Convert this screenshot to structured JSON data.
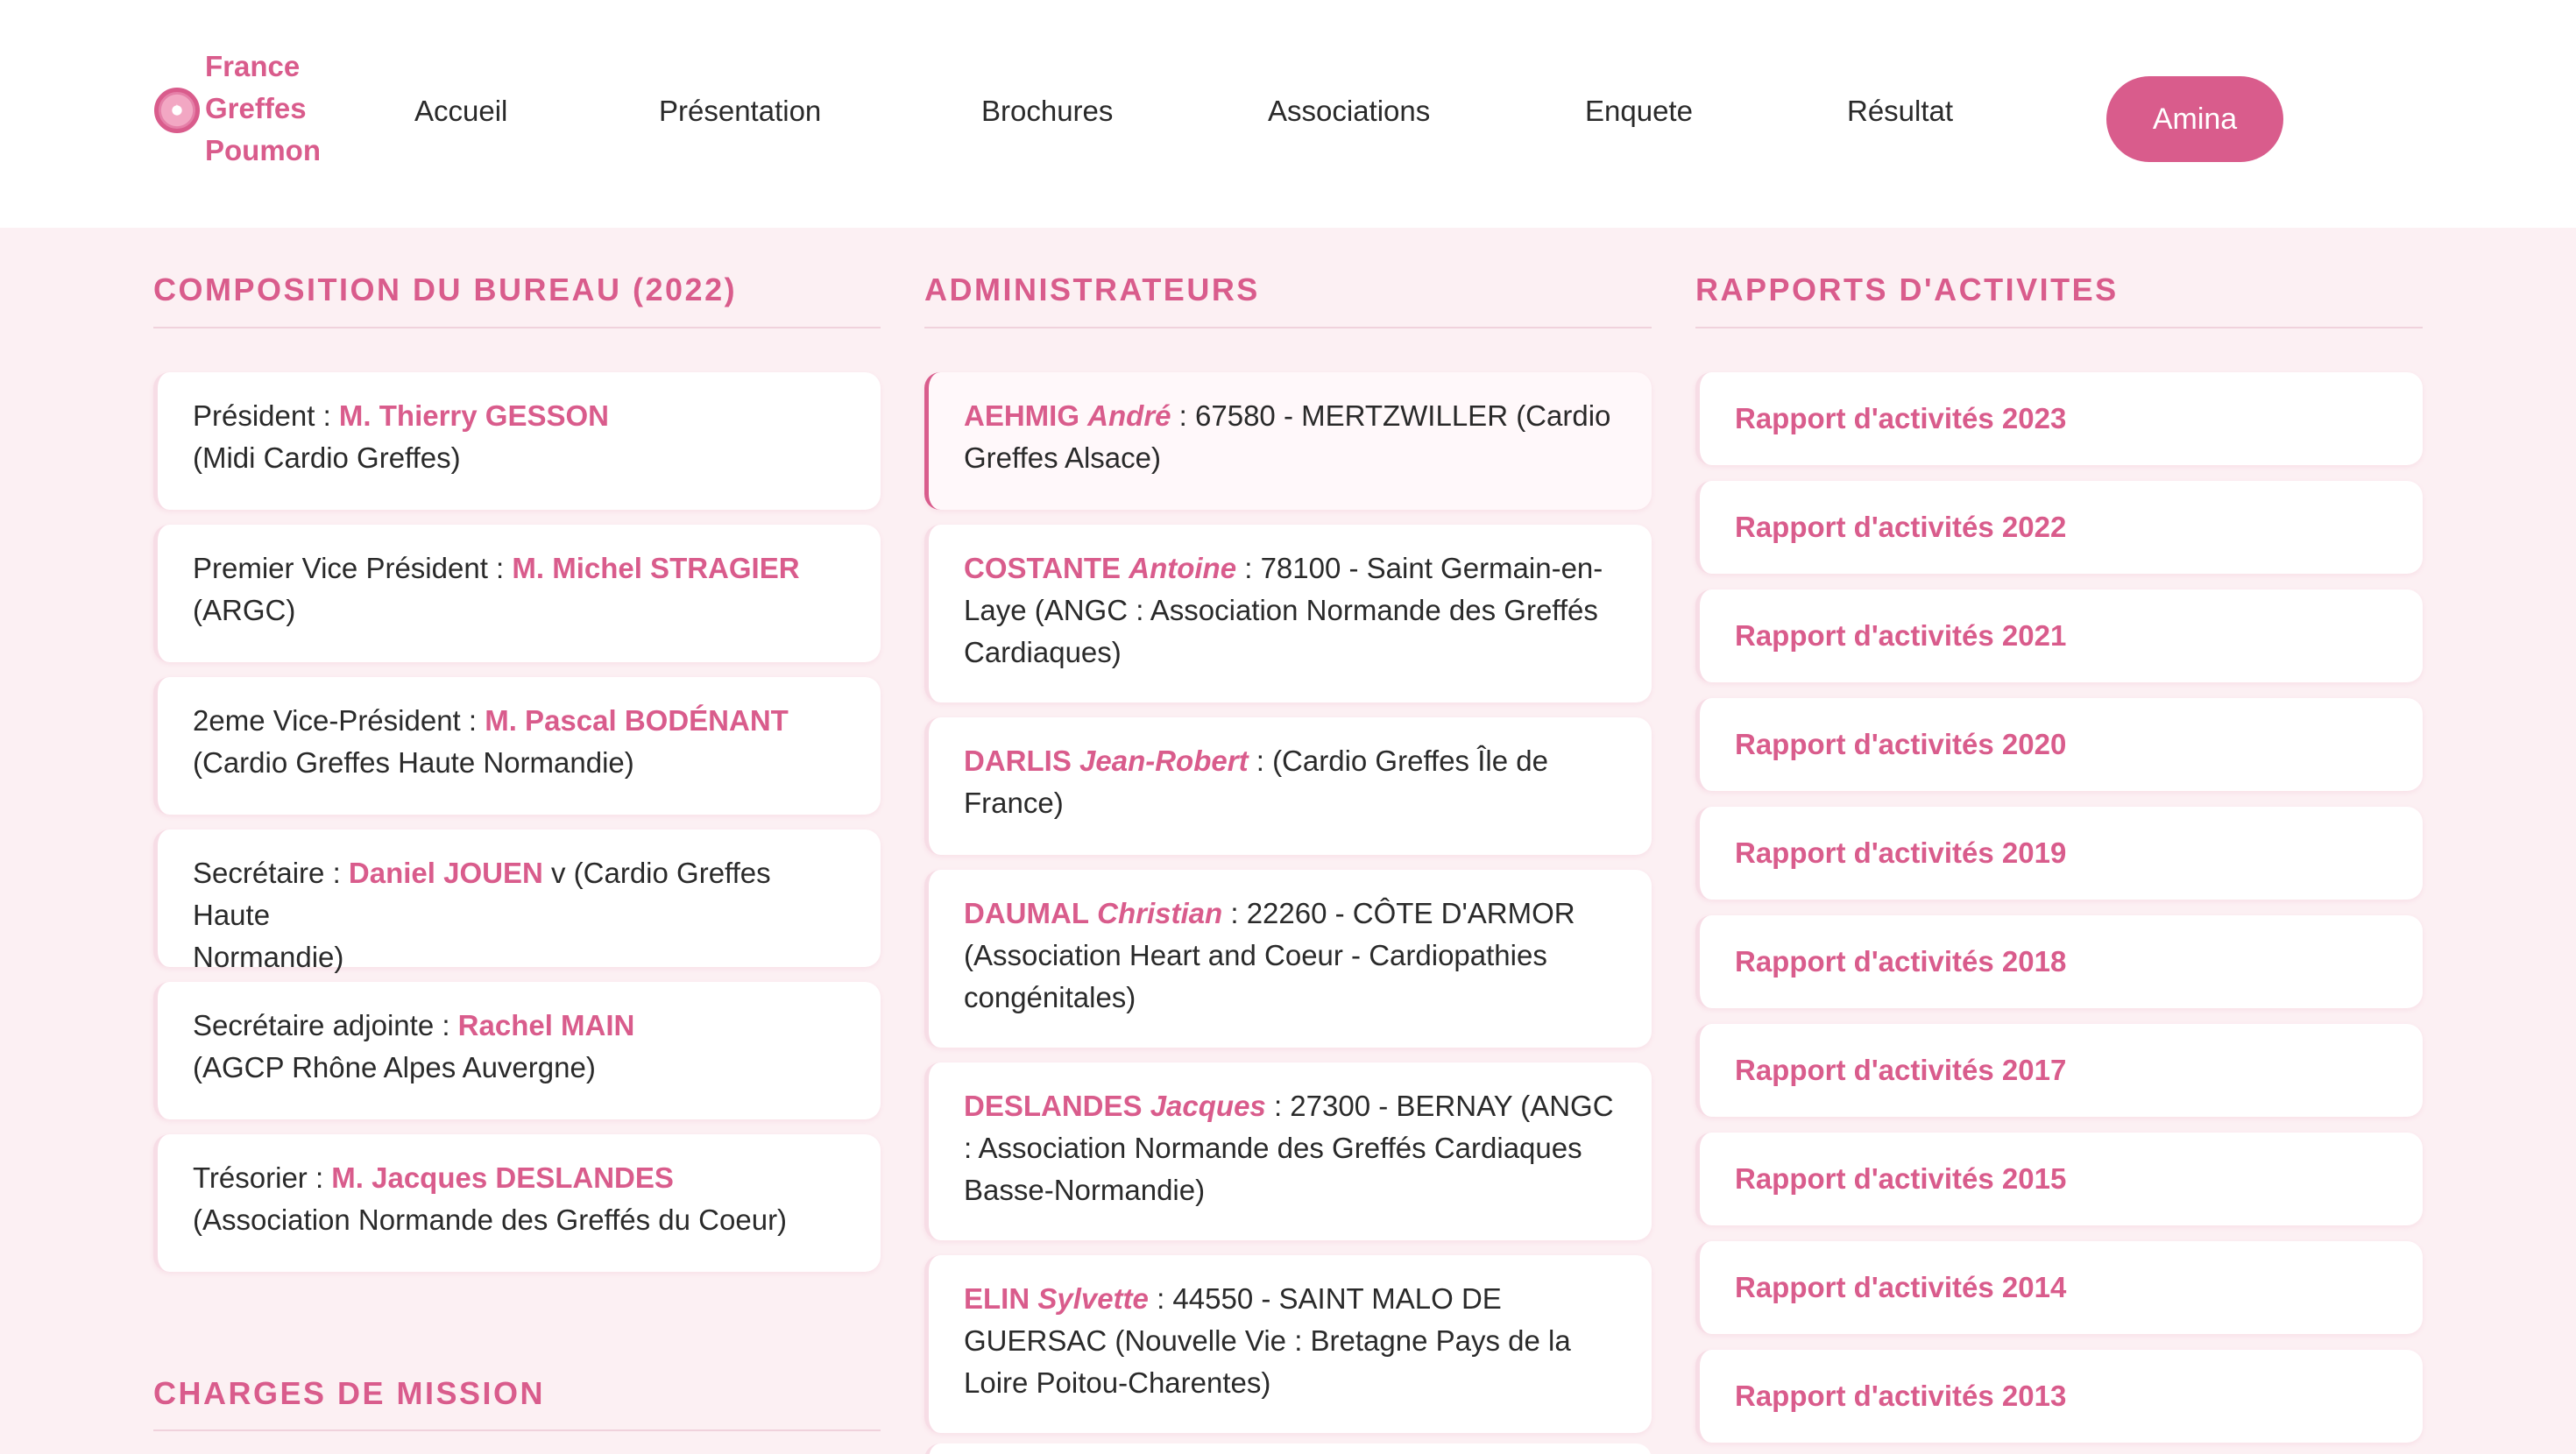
{
  "brand": {
    "line1": "France",
    "line2": "Greffes",
    "line3": "Poumon",
    "accent_color": "#d95c8c"
  },
  "nav": {
    "items": [
      "Accueil",
      "Présentation",
      "Brochures",
      "Associations",
      "Enquete",
      "Résultat"
    ],
    "user_button": "Amina"
  },
  "bureau": {
    "title": "COMPOSITION DU BUREAU (2022)",
    "members": [
      {
        "role": "Président : ",
        "name": "M. Thierry GESSON",
        "after": "",
        "org": "(Midi Cardio Greffes)"
      },
      {
        "role": "Premier Vice Président : ",
        "name": "M. Michel STRAGIER",
        "after": "",
        "org": "(ARGC)"
      },
      {
        "role": "2eme Vice-Président : ",
        "name": "M. Pascal BODÉNANT",
        "after": "",
        "org": "(Cardio Greffes Haute Normandie)"
      },
      {
        "role": "Secrétaire : ",
        "name": "Daniel JOUEN",
        "after": " v (Cardio Greffes Haute",
        "org": "Normandie)"
      },
      {
        "role": "Secrétaire adjointe : ",
        "name": "Rachel MAIN",
        "after": "",
        "org": "(AGCP Rhône Alpes Auvergne)"
      },
      {
        "role": "Trésorier : ",
        "name": "M. Jacques DESLANDES",
        "after": "",
        "org": "(Association Normande des Greffés du Coeur)"
      }
    ]
  },
  "admins": {
    "title": "ADMINISTRATEURS",
    "items": [
      {
        "last": "AEHMIG",
        "first": "André",
        "details": " : 67580 - MERTZWILLER (Cardio Greffes Alsace)"
      },
      {
        "last": "COSTANTE",
        "first": "Antoine",
        "details": " : 78100 - Saint Germain-en-Laye (ANGC : Association Normande des Greffés Cardiaques)"
      },
      {
        "last": "DARLIS",
        "first": "Jean-Robert",
        "details": " : (Cardio Greffes Île de France)"
      },
      {
        "last": "DAUMAL",
        "first": "Christian",
        "details": " : 22260 - CÔTE D'ARMOR (Association Heart and Coeur - Cardiopathies congénitales)"
      },
      {
        "last": "DESLANDES",
        "first": "Jacques",
        "details": " : 27300 - BERNAY (ANGC : Association Normande des Greffés Cardiaques Basse-Normandie)"
      },
      {
        "last": "ELIN",
        "first": "Sylvette",
        "details": " : 44550 - SAINT MALO DE GUERSAC (Nouvelle Vie : Bretagne Pays de la Loire Poitou-Charentes)"
      }
    ]
  },
  "reports": {
    "title": "RAPPORTS D'ACTIVITES",
    "items": [
      "Rapport d'activités 2023",
      "Rapport d'activités 2022",
      "Rapport d'activités 2021",
      "Rapport d'activités 2020",
      "Rapport d'activités 2019",
      "Rapport d'activités 2018",
      "Rapport d'activités 2017",
      "Rapport d'activités 2015",
      "Rapport d'activités 2014",
      "Rapport d'activités 2013"
    ]
  },
  "charges": {
    "title": "CHARGES DE MISSION"
  }
}
